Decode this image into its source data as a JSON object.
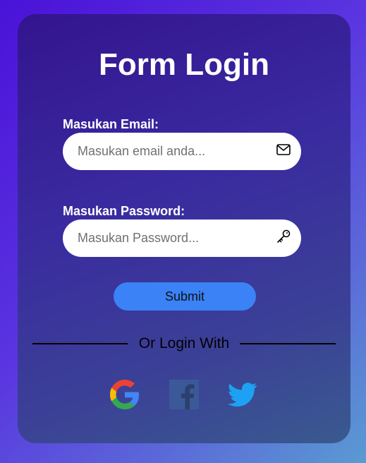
{
  "form": {
    "title": "Form Login",
    "email": {
      "label": "Masukan Email:",
      "placeholder": "Masukan email anda...",
      "value": "",
      "icon": "mail-icon"
    },
    "password": {
      "label": "Masukan Password:",
      "placeholder": "Masukan Password...",
      "value": "",
      "icon": "key-icon"
    },
    "submit_label": "Submit",
    "divider_text": "Or Login With",
    "social": [
      {
        "icon": "google-icon",
        "color": "#4285F4"
      },
      {
        "icon": "facebook-icon",
        "color": "#3b5998"
      },
      {
        "icon": "twitter-icon",
        "color": "#1DA1F2"
      }
    ]
  },
  "colors": {
    "accent": "#3a82f6",
    "card": "#3a2aa0",
    "background": "#5a35e0"
  }
}
